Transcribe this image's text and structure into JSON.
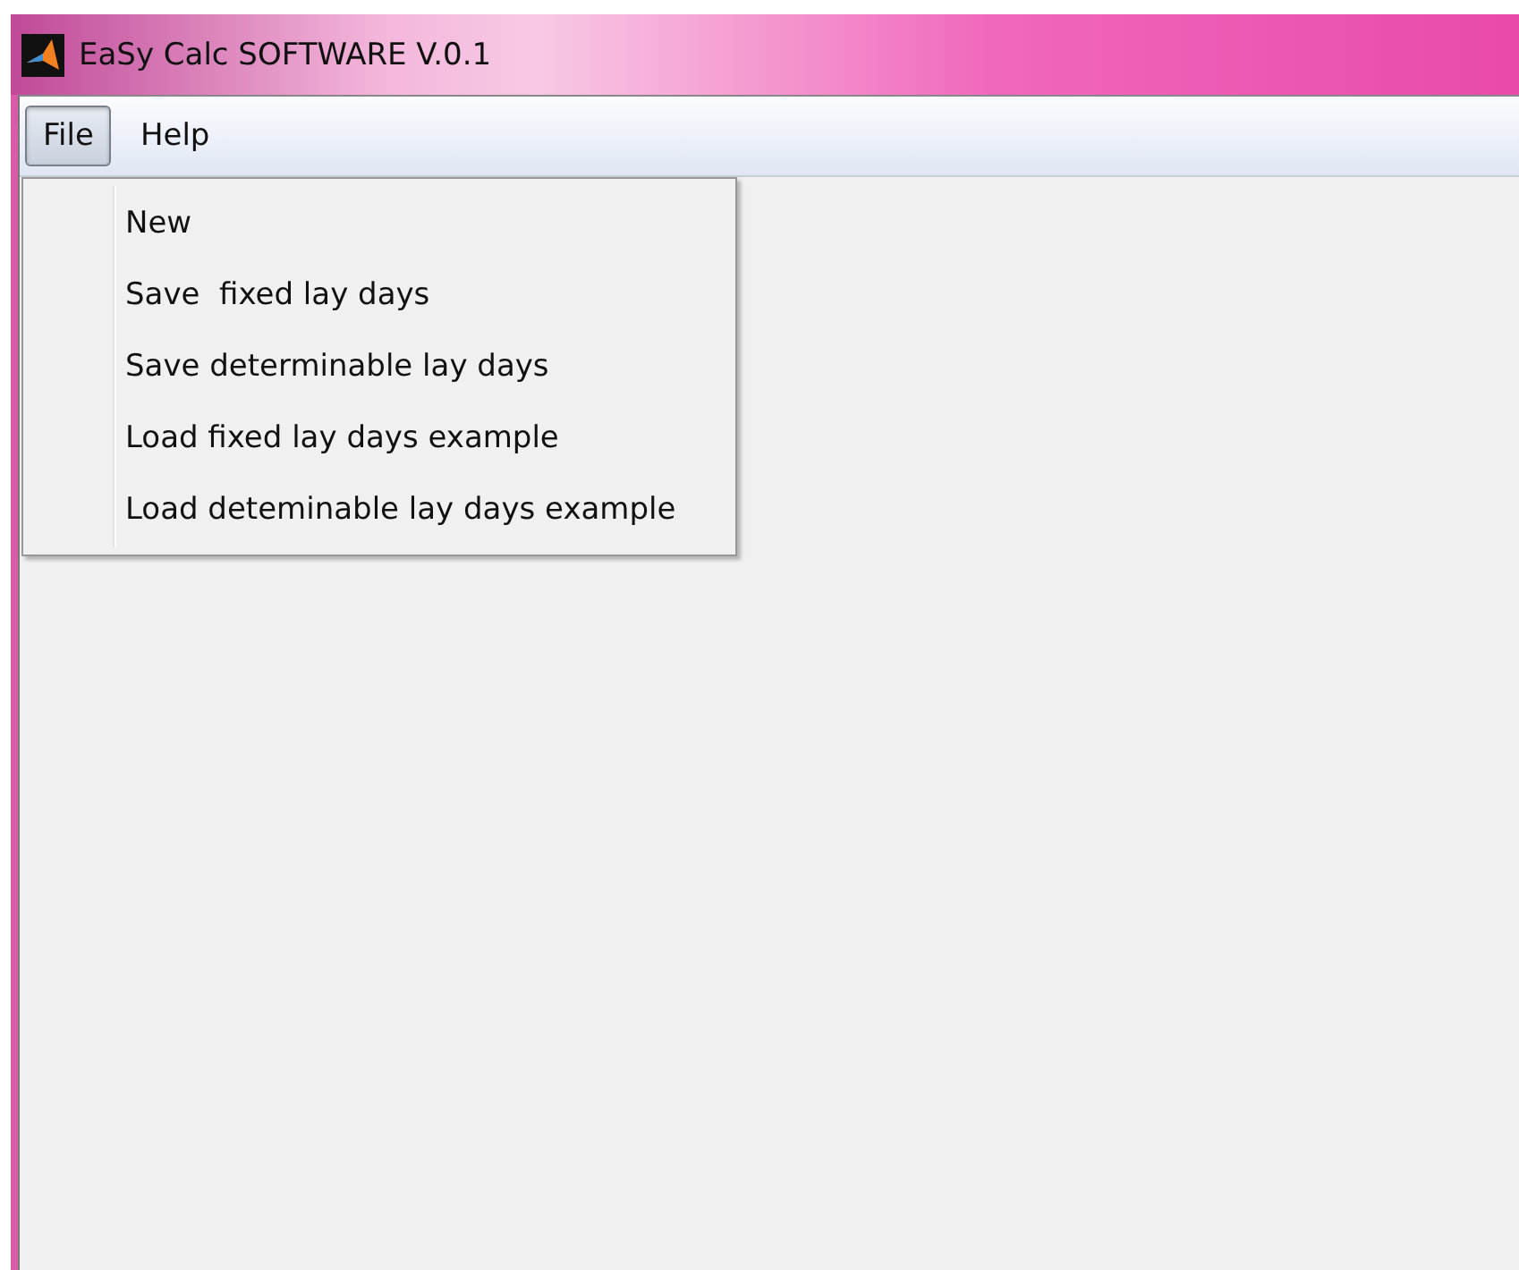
{
  "window": {
    "title": "EaSy Calc SOFTWARE V.0.1"
  },
  "menubar": [
    {
      "label": "File",
      "selected": true
    },
    {
      "label": "Help",
      "selected": false
    }
  ],
  "dropdown": {
    "items": [
      "New",
      "Save  fixed lay days",
      "Save determinable lay days",
      "Load fixed lay days example",
      "Load deteminable lay days example"
    ]
  }
}
